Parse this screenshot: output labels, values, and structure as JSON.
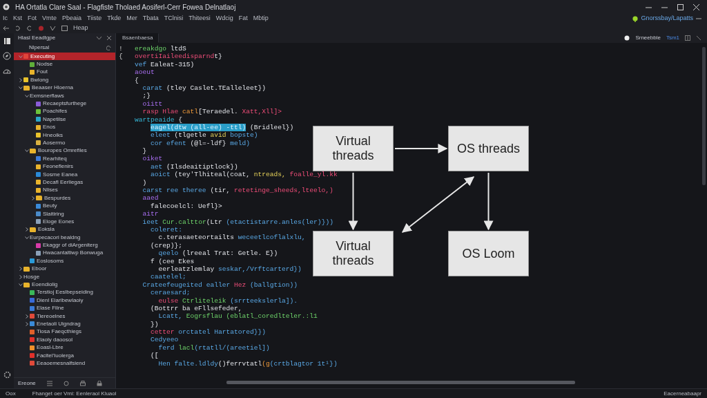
{
  "window": {
    "title": "HA Ortatla Clare Saal - Flagfiste Tholaed Aosiferl-Cerr Fowea Delnatlaoj"
  },
  "menu": [
    "Ic",
    "Kst",
    "Fot",
    "Vmte",
    "Pbeaia",
    "Tiiste",
    "Tkde",
    "Mer",
    "Tbata",
    "TClnisi",
    "Thiteesi",
    "Wdcig",
    "Fat",
    "Mbtip"
  ],
  "account": {
    "label": "Gnorssbay/Lapatts"
  },
  "toolbar": {
    "label": "Heap"
  },
  "explorer": {
    "title": "Hlasl Eeadtgpe",
    "section": "Nlpersal",
    "tree": [
      {
        "label": "Executing",
        "kind": "file",
        "color": "#e0443a",
        "selected": true,
        "expanded": true,
        "children": [
          {
            "label": "Nodse",
            "kind": "file",
            "color": "#5fae3a",
            "selected": false
          },
          {
            "label": "Fout",
            "kind": "file",
            "color": "#e8b32c",
            "selected": false
          }
        ]
      },
      {
        "label": "Bwlong",
        "kind": "file",
        "color": "#e8c22c",
        "selected": false,
        "expanded": false
      },
      {
        "label": "Beaaser Hloerna",
        "kind": "folder",
        "color": "#e8b32c",
        "selected": false,
        "expanded": true,
        "children": [
          {
            "label": "Exmsnerflaws",
            "kind": "label",
            "selected": false,
            "expanded": true,
            "children": [
              {
                "label": "Recaeptsfurthege",
                "kind": "file",
                "color": "#8a5cd8",
                "selected": false
              },
              {
                "label": "Poachifes",
                "kind": "file",
                "color": "#6cc23a",
                "selected": false
              },
              {
                "label": "Napetilse",
                "kind": "file",
                "color": "#2aa6c8",
                "selected": false
              },
              {
                "label": "Enos",
                "kind": "file",
                "color": "#e8b32c",
                "selected": false
              },
              {
                "label": "Hneoiks",
                "kind": "file",
                "color": "#e8c22c",
                "selected": false
              },
              {
                "label": "Aoserrno",
                "kind": "file",
                "color": "#d8b040",
                "selected": false
              }
            ]
          },
          {
            "label": "Bouropes Omrefiles",
            "kind": "folder",
            "color": "#e8b32c",
            "selected": false,
            "expanded": true,
            "children": [
              {
                "label": "Rearhiteq",
                "kind": "file",
                "color": "#3a7ad8",
                "selected": false
              },
              {
                "label": "Feoneflenirs",
                "kind": "file",
                "color": "#e8b32c",
                "selected": false
              },
              {
                "label": "Sosme Eanea",
                "kind": "file",
                "color": "#2a8ad8",
                "selected": false
              },
              {
                "label": "Decafl Eerliegas",
                "kind": "file",
                "color": "#e8b32c",
                "selected": false
              },
              {
                "label": "Nlises",
                "kind": "file",
                "color": "#e8b32c",
                "selected": false
              },
              {
                "label": "Bespurdes",
                "kind": "folder",
                "color": "#e8b32c",
                "selected": false,
                "expanded": false
              },
              {
                "label": "Beuty",
                "kind": "file",
                "color": "#3a8ad8",
                "selected": false
              },
              {
                "label": "Slaitiring",
                "kind": "file",
                "color": "#4a8ac8",
                "selected": false
              },
              {
                "label": "Eloge Eones",
                "kind": "file",
                "color": "#8aa0b8",
                "selected": false
              }
            ]
          },
          {
            "label": "Eoksla",
            "kind": "folder",
            "color": "#e8b32c",
            "selected": false,
            "expanded": false
          },
          {
            "label": "Eurpecacori bealdng",
            "kind": "label",
            "selected": false,
            "expanded": true,
            "children": [
              {
                "label": "Ekaggr of diArgeniterg",
                "kind": "file",
                "color": "#d83aa8",
                "selected": false
              },
              {
                "label": "Hwacantaltiwp Bonwuga",
                "kind": "file",
                "color": "#8aa0b8",
                "selected": false
              }
            ]
          },
          {
            "label": "Eoslosoms",
            "kind": "file",
            "color": "#2a9ad8",
            "selected": false
          }
        ]
      },
      {
        "label": "Eboor",
        "kind": "folder",
        "color": "#e8b32c",
        "selected": false,
        "expanded": false
      },
      {
        "label": "Hosge",
        "kind": "label",
        "selected": false,
        "expanded": false
      },
      {
        "label": "Eoendiolig",
        "kind": "folder",
        "color": "#e8b32c",
        "selected": false,
        "expanded": true,
        "children": [
          {
            "label": "Terstioj Eeslbepseiding",
            "kind": "file",
            "color": "#3ab85a",
            "selected": false
          },
          {
            "label": "Dienl Eiarlbewlaoiy",
            "kind": "file",
            "color": "#3a6ad8",
            "selected": false
          },
          {
            "label": "Elase Filne",
            "kind": "file",
            "color": "#3a7ad8",
            "selected": false
          },
          {
            "label": "Tiereoelnes",
            "kind": "file",
            "color": "#e04a3a",
            "selected": false,
            "expanded": false
          },
          {
            "label": "Enetaoli Uigndrag",
            "kind": "file",
            "color": "#3a8ad8",
            "selected": false,
            "expanded": false
          },
          {
            "label": "Tiosa Faeqcthiegs",
            "kind": "file",
            "color": "#e0602a",
            "selected": false
          },
          {
            "label": "Elaoly daoosol",
            "kind": "file",
            "color": "#e0302a",
            "selected": false
          },
          {
            "label": "Eoasl-Lbre",
            "kind": "file",
            "color": "#f0902a",
            "selected": false
          },
          {
            "label": "Facitel'Iuolerga",
            "kind": "file",
            "color": "#e0302a",
            "selected": false
          },
          {
            "label": "Eeaoemesnalfsiend",
            "kind": "file",
            "color": "#e04a3a",
            "selected": false
          }
        ]
      }
    ],
    "footer": "Ereone"
  },
  "editor": {
    "tab": "Bsaenbaesa",
    "branch": "Srneebble",
    "mode": "Tsm1",
    "lines": [
      {
        "mark": "!",
        "tokens": [
          {
            "kind": "green",
            "text": "ereakdgo "
          },
          {
            "kind": "plain",
            "text": "ltdS"
          }
        ]
      },
      {
        "mark": "{",
        "tokens": [
          {
            "kind": "pink",
            "text": "overtiIaileedisparnd"
          },
          {
            "kind": "plain",
            "text": "t}"
          }
        ]
      },
      {
        "tokens": [
          {
            "kind": "blue",
            "text": "vef "
          },
          {
            "kind": "plain",
            "text": "Ealeat-315)"
          }
        ]
      },
      {
        "tokens": [
          {
            "kind": "purple",
            "text": "aoeut"
          }
        ]
      },
      {
        "tokens": [
          {
            "kind": "plain",
            "text": "{"
          }
        ]
      },
      {
        "tokens": [
          {
            "kind": "blue",
            "text": "  carat "
          },
          {
            "kind": "plain",
            "text": "(tley Caslet.TEalleleet})"
          }
        ]
      },
      {
        "tokens": [
          {
            "kind": "plain",
            "text": "  ;}"
          }
        ]
      },
      {
        "tokens": [
          {
            "kind": "purple",
            "text": "  oiitt"
          }
        ]
      },
      {
        "tokens": [
          {
            "kind": "pink",
            "text": "  rasp Hlae "
          },
          {
            "kind": "orange",
            "text": "catl"
          },
          {
            "kind": "plain",
            "text": "[Teraedel. "
          },
          {
            "kind": "pink",
            "text": "Xatt,Xll]>"
          }
        ]
      },
      {
        "tokens": [
          {
            "kind": "cyan",
            "text": "wartpeaide "
          },
          {
            "kind": "plain",
            "text": "{"
          }
        ]
      },
      {
        "tokens": [
          {
            "kind": "selected",
            "text": "eagel(dtw (all-ee) -ttl)"
          },
          {
            "kind": "plain",
            "text": " (Bridleel})"
          }
        ]
      },
      {
        "tokens": [
          {
            "kind": "blue",
            "text": "    eleet "
          },
          {
            "kind": "plain",
            "text": "(tlgetle "
          },
          {
            "kind": "yellow",
            "text": "avid "
          },
          {
            "kind": "blue",
            "text": "bopste)"
          }
        ]
      },
      {
        "tokens": [
          {
            "kind": "blue",
            "text": "    cor efent "
          },
          {
            "kind": "plain",
            "text": "(@l=-ldf} "
          },
          {
            "kind": "blue",
            "text": "meld)"
          }
        ]
      },
      {
        "tokens": [
          {
            "kind": "plain",
            "text": "  }"
          }
        ]
      },
      {
        "tokens": [
          {
            "kind": "purple",
            "text": "  oiket"
          }
        ]
      },
      {
        "tokens": [
          {
            "kind": "blue",
            "text": "    aet "
          },
          {
            "kind": "plain",
            "text": "(Ilsdeaitiptlock})"
          }
        ]
      },
      {
        "tokens": [
          {
            "kind": "blue",
            "text": "    aoict "
          },
          {
            "kind": "plain",
            "text": "(tey'Tlhiteal(coat, "
          },
          {
            "kind": "yellow",
            "text": "ntreads, "
          },
          {
            "kind": "pink",
            "text": "foalle_yl.kk"
          }
        ]
      },
      {
        "tokens": [
          {
            "kind": "plain",
            "text": "  )"
          }
        ]
      },
      {
        "tokens": [
          {
            "kind": "blue",
            "text": "  carst ree theree "
          },
          {
            "kind": "plain",
            "text": "(tir, "
          },
          {
            "kind": "pink",
            "text": "retetinge_sheeds,lteelo,)"
          }
        ]
      },
      {
        "tokens": [
          {
            "kind": "purple",
            "text": "  aaed"
          }
        ]
      },
      {
        "tokens": [
          {
            "kind": "plain",
            "text": "    falecoelcl: Uefl}>"
          }
        ]
      },
      {
        "tokens": [
          {
            "kind": "purple",
            "text": "  aitr"
          }
        ]
      },
      {
        "tokens": [
          {
            "kind": "blue",
            "text": "  ieet "
          },
          {
            "kind": "green",
            "text": "Cur.calttor"
          },
          {
            "kind": "plain",
            "text": "(Ltr "
          },
          {
            "kind": "blue",
            "text": "(etactistarre.anles(ler)}))"
          }
        ]
      },
      {
        "tokens": [
          {
            "kind": "blue",
            "text": "    coleret:"
          }
        ]
      },
      {
        "tokens": [
          {
            "kind": "plain",
            "text": "      c.terasaeteortailts "
          },
          {
            "kind": "blue",
            "text": "weceetlcoflalxlu,"
          }
        ]
      },
      {
        "tokens": [
          {
            "kind": "plain",
            "text": "    (crep)};"
          }
        ]
      },
      {
        "tokens": [
          {
            "kind": "blue",
            "text": "      qeelo "
          },
          {
            "kind": "plain",
            "text": "(lreeal Trat: Getle. E})"
          }
        ]
      },
      {
        "tokens": [
          {
            "kind": "plain",
            "text": "    f (cee Ekes"
          }
        ]
      },
      {
        "tokens": [
          {
            "kind": "plain",
            "text": "      eerleatzlemlay "
          },
          {
            "kind": "blue",
            "text": "seskar,/Vrftcarterd})"
          }
        ]
      },
      {
        "tokens": [
          {
            "kind": "blue",
            "text": "    caatelel;"
          }
        ]
      },
      {
        "tokens": [
          {
            "kind": "blue",
            "text": "  Crateefeugeited ealler "
          },
          {
            "kind": "pink",
            "text": "Hez "
          },
          {
            "kind": "blue",
            "text": "(ballgtion))"
          }
        ]
      },
      {
        "tokens": [
          {
            "kind": "blue",
            "text": "    ceraesard;"
          }
        ]
      },
      {
        "tokens": [
          {
            "kind": "pink",
            "text": "      eulse "
          },
          {
            "kind": "green",
            "text": "Ctrliteleik "
          },
          {
            "kind": "blue",
            "text": "(srrteekslerla])."
          }
        ]
      },
      {
        "tokens": [
          {
            "kind": "plain",
            "text": "    (Bottrr ba eFllsefeder,"
          }
        ]
      },
      {
        "tokens": [
          {
            "kind": "blue",
            "text": "      Lcatt, "
          },
          {
            "kind": "green",
            "text": "Eogrsflau (eblatl_coredlteler.:l1"
          }
        ]
      },
      {
        "tokens": [
          {
            "kind": "plain",
            "text": "    })"
          }
        ]
      },
      {
        "tokens": [
          {
            "kind": "pink",
            "text": "    cetter "
          },
          {
            "kind": "blue",
            "text": "orctatel Hartatored}})"
          }
        ]
      },
      {
        "tokens": [
          {
            "kind": "blue",
            "text": "    Cedyeeo"
          }
        ]
      },
      {
        "tokens": [
          {
            "kind": "blue",
            "text": "      ferd "
          },
          {
            "kind": "green",
            "text": "lacl"
          },
          {
            "kind": "blue",
            "text": "(rtatll/(areetiel])"
          }
        ]
      },
      {
        "tokens": [
          {
            "kind": "plain",
            "text": "    (["
          }
        ]
      },
      {
        "tokens": [
          {
            "kind": "blue",
            "text": "      Hen falte.ldldy"
          },
          {
            "kind": "plain",
            "text": "()ferrvtatl"
          },
          {
            "kind": "orange",
            "text": "(g"
          },
          {
            "kind": "blue",
            "text": "(crtblagtor 1t¹})"
          }
        ]
      }
    ]
  },
  "diagram": {
    "nodes": [
      {
        "label": "Virtual threads"
      },
      {
        "label": "OS threads"
      },
      {
        "label": "Virtual threads"
      },
      {
        "label": "OS Loom"
      }
    ]
  },
  "status_bar": {
    "left": "Oox",
    "message": "Fhanget oer Vmi: Eenleraol Kluaol",
    "right": "Eacerneabaapr"
  }
}
